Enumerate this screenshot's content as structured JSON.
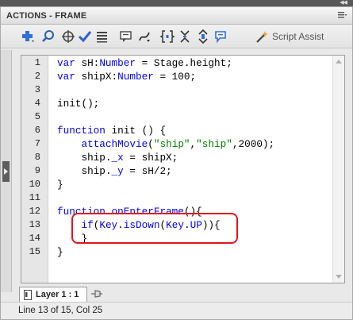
{
  "window": {
    "title": "ACTIONS - FRAME",
    "collapse_glyph": "◀◀"
  },
  "toolbar": {
    "icons": [
      "add-statement-icon",
      "find-icon",
      "target-path-icon",
      "check-syntax-icon",
      "auto-format-icon",
      "code-hint-icon",
      "debug-options-icon",
      "collapse-braces-icon",
      "collapse-selection-icon",
      "expand-all-icon",
      "apply-comment-icon"
    ],
    "script_assist_label": "Script Assist"
  },
  "editor": {
    "line_numbers": [
      "1",
      "2",
      "3",
      "4",
      "5",
      "6",
      "7",
      "8",
      "9",
      "10",
      "11",
      "12",
      "13",
      "14",
      "15"
    ],
    "lines": [
      [
        {
          "t": "var",
          "c": "kw"
        },
        {
          "t": " sH:"
        },
        {
          "t": "Number",
          "c": "kw"
        },
        {
          "t": " = Stage.height;"
        }
      ],
      [
        {
          "t": "var",
          "c": "kw"
        },
        {
          "t": " shipX:"
        },
        {
          "t": "Number",
          "c": "kw"
        },
        {
          "t": " = 100;"
        }
      ],
      [],
      [
        {
          "t": "init();"
        }
      ],
      [],
      [
        {
          "t": "function",
          "c": "kw"
        },
        {
          "t": " init () {"
        }
      ],
      [
        {
          "t": "    "
        },
        {
          "t": "attachMovie",
          "c": "kw"
        },
        {
          "t": "("
        },
        {
          "t": "\"ship\"",
          "c": "str"
        },
        {
          "t": ","
        },
        {
          "t": "\"ship\"",
          "c": "str"
        },
        {
          "t": ",2000);"
        }
      ],
      [
        {
          "t": "    ship."
        },
        {
          "t": "_x",
          "c": "kw"
        },
        {
          "t": " = shipX;"
        }
      ],
      [
        {
          "t": "    ship."
        },
        {
          "t": "_y",
          "c": "kw"
        },
        {
          "t": " = sH/2;"
        }
      ],
      [
        {
          "t": "}"
        }
      ],
      [],
      [
        {
          "t": "function",
          "c": "kw"
        },
        {
          "t": " "
        },
        {
          "t": "onEnterFrame",
          "c": "kw"
        },
        {
          "t": "(){"
        }
      ],
      [
        {
          "t": "    "
        },
        {
          "t": "if",
          "c": "kw"
        },
        {
          "t": "("
        },
        {
          "t": "Key",
          "c": "kw"
        },
        {
          "t": "."
        },
        {
          "t": "isDown",
          "c": "kw"
        },
        {
          "t": "("
        },
        {
          "t": "Key",
          "c": "kw"
        },
        {
          "t": "."
        },
        {
          "t": "UP",
          "c": "kw"
        },
        {
          "t": ")){"
        }
      ],
      [
        {
          "t": "    }"
        }
      ],
      [
        {
          "t": "}"
        }
      ]
    ],
    "highlight_color": "#e8141c",
    "colors": {
      "keyword": "#0000ff",
      "string": "#008000"
    }
  },
  "layer_tab": {
    "label": "Layer 1 : 1"
  },
  "status_bar": {
    "text": "Line 13 of 15, Col 25"
  }
}
